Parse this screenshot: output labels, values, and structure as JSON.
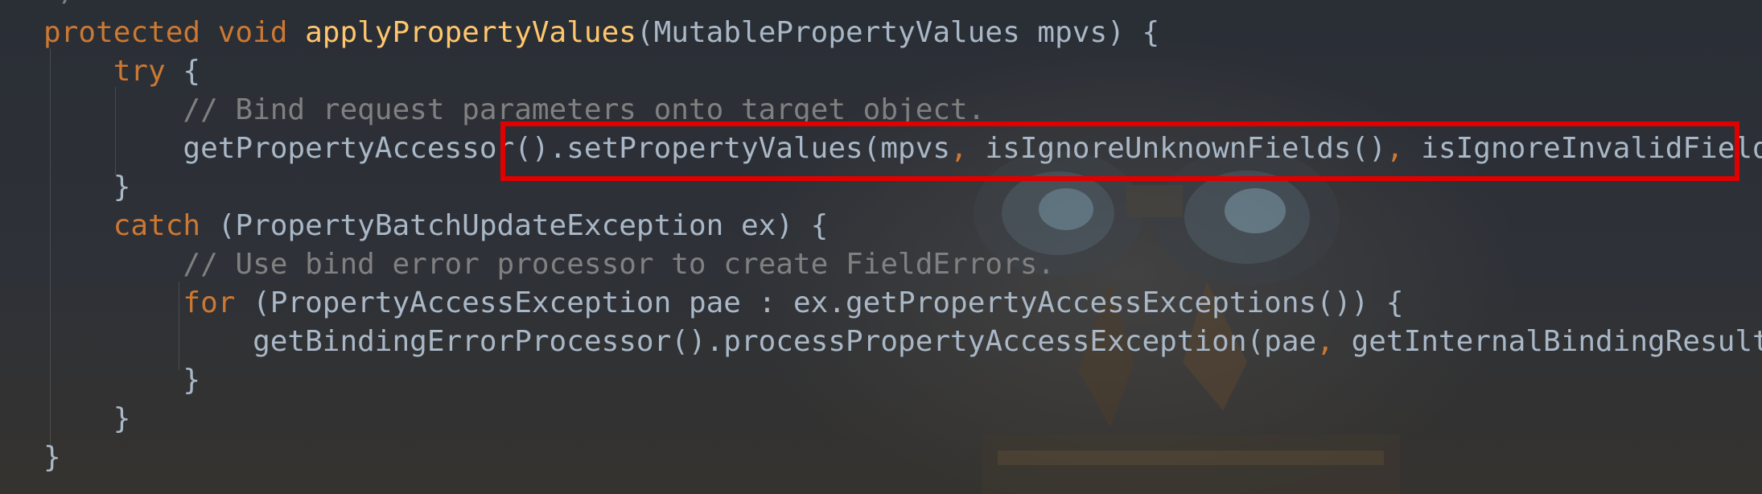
{
  "editor": {
    "top_fragment": "*/",
    "colors": {
      "keyword": "#cc7832",
      "method": "#ffc66d",
      "comment": "#808080",
      "default": "#a9b7c6",
      "highlight_border": "#e00000",
      "background": "#2b2f35"
    },
    "lines": [
      {
        "tokens": [
          {
            "text": "protected void ",
            "kind": "kw"
          },
          {
            "text": "applyPropertyValues",
            "kind": "fn"
          },
          {
            "text": "(MutablePropertyValues mpvs) {",
            "kind": "df"
          }
        ]
      },
      {
        "tokens": [
          {
            "text": "    ",
            "kind": "df"
          },
          {
            "text": "try",
            "kind": "kw"
          },
          {
            "text": " {",
            "kind": "df"
          }
        ]
      },
      {
        "tokens": [
          {
            "text": "        // Bind request parameters onto target object.",
            "kind": "cm"
          }
        ]
      },
      {
        "tokens": [
          {
            "text": "        getPropertyAccessor().setPropertyValues(mpvs",
            "kind": "df"
          },
          {
            "text": ", ",
            "kind": "pn"
          },
          {
            "text": "isIgnoreUnknownFields()",
            "kind": "df"
          },
          {
            "text": ", ",
            "kind": "pn"
          },
          {
            "text": "isIgnoreInvalidFields())",
            "kind": "df"
          },
          {
            "text": ";",
            "kind": "pn"
          }
        ]
      },
      {
        "tokens": [
          {
            "text": "    }",
            "kind": "df"
          }
        ]
      },
      {
        "tokens": [
          {
            "text": "    ",
            "kind": "df"
          },
          {
            "text": "catch",
            "kind": "kw"
          },
          {
            "text": " (PropertyBatchUpdateException ex) {",
            "kind": "df"
          }
        ]
      },
      {
        "tokens": [
          {
            "text": "        // Use bind error processor to create FieldErrors.",
            "kind": "cm"
          }
        ]
      },
      {
        "tokens": [
          {
            "text": "        ",
            "kind": "df"
          },
          {
            "text": "for",
            "kind": "kw"
          },
          {
            "text": " (PropertyAccessException pae : ex.getPropertyAccessExceptions()) {",
            "kind": "df"
          }
        ]
      },
      {
        "tokens": [
          {
            "text": "            getBindingErrorProcessor().processPropertyAccessException(pae",
            "kind": "df"
          },
          {
            "text": ", ",
            "kind": "pn"
          },
          {
            "text": "getInternalBindingResult())",
            "kind": "df"
          },
          {
            "text": ";",
            "kind": "pn"
          }
        ]
      },
      {
        "tokens": [
          {
            "text": "        }",
            "kind": "df"
          }
        ]
      },
      {
        "tokens": [
          {
            "text": "    }",
            "kind": "df"
          }
        ]
      },
      {
        "tokens": [
          {
            "text": "}",
            "kind": "df"
          }
        ]
      }
    ]
  }
}
